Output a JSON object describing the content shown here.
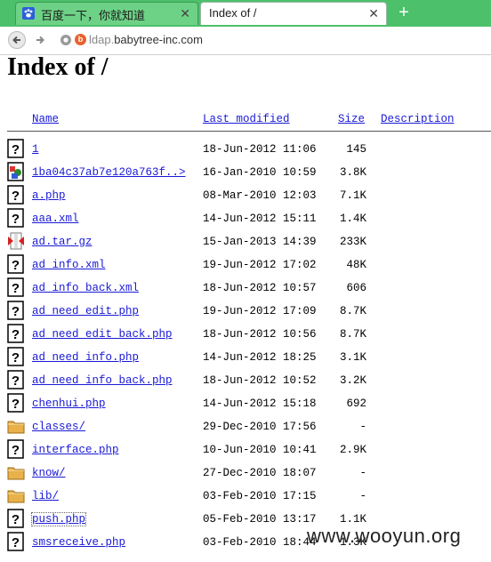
{
  "browser": {
    "tabs": [
      {
        "label": "百度一下，你就知道",
        "close": "✕"
      },
      {
        "label": "Index of /",
        "close": "✕"
      }
    ],
    "new_tab": "+",
    "url_prefix": "ldap.",
    "url_rest": "babytree-inc.com",
    "site_badge": "b"
  },
  "page": {
    "title": "Index of /",
    "columns": {
      "name": "Name",
      "modified": "Last modified",
      "size": "Size",
      "description": "Description"
    },
    "rows": [
      {
        "icon": "unknown-file",
        "name": "1",
        "date": "18-Jun-2012 11:06",
        "size": "145"
      },
      {
        "icon": "image-file",
        "name": "1ba04c37ab7e120a763f..>",
        "date": "16-Jan-2010 10:59",
        "size": "3.8K"
      },
      {
        "icon": "unknown-file",
        "name": "a.php",
        "date": "08-Mar-2010 12:03",
        "size": "7.1K"
      },
      {
        "icon": "unknown-file",
        "name": "aaa.xml",
        "date": "14-Jun-2012 15:11",
        "size": "1.4K"
      },
      {
        "icon": "archive-file",
        "name": "ad.tar.gz",
        "date": "15-Jan-2013 14:39",
        "size": "233K"
      },
      {
        "icon": "unknown-file",
        "name": "ad_info.xml",
        "date": "19-Jun-2012 17:02",
        "size": "48K"
      },
      {
        "icon": "unknown-file",
        "name": "ad_info_back.xml",
        "date": "18-Jun-2012 10:57",
        "size": "606"
      },
      {
        "icon": "unknown-file",
        "name": "ad_need_edit.php",
        "date": "19-Jun-2012 17:09",
        "size": "8.7K"
      },
      {
        "icon": "unknown-file",
        "name": "ad_need_edit_back.php",
        "date": "18-Jun-2012 10:56",
        "size": "8.7K"
      },
      {
        "icon": "unknown-file",
        "name": "ad_need_info.php",
        "date": "14-Jun-2012 18:25",
        "size": "3.1K"
      },
      {
        "icon": "unknown-file",
        "name": "ad_need_info_back.php",
        "date": "18-Jun-2012 10:52",
        "size": "3.2K"
      },
      {
        "icon": "unknown-file",
        "name": "chenhui.php",
        "date": "14-Jun-2012 15:18",
        "size": "692"
      },
      {
        "icon": "folder",
        "name": "classes/",
        "date": "29-Dec-2010 17:56",
        "size": "-"
      },
      {
        "icon": "unknown-file",
        "name": "interface.php",
        "date": "10-Jun-2010 10:41",
        "size": "2.9K"
      },
      {
        "icon": "folder",
        "name": "know/",
        "date": "27-Dec-2010 18:07",
        "size": "-"
      },
      {
        "icon": "folder",
        "name": "lib/",
        "date": "03-Feb-2010 17:15",
        "size": "-"
      },
      {
        "icon": "unknown-file",
        "name": "push.php",
        "date": "05-Feb-2010 13:17",
        "size": "1.1K"
      },
      {
        "icon": "unknown-file",
        "name": "smsreceive.php",
        "date": "03-Feb-2010 18:44",
        "size": "1.3K"
      }
    ]
  },
  "watermark": "www.wooyun.org",
  "colors": {
    "tabbar": "#4cc06a",
    "link": "#1a1ad6",
    "folder": "#e8b14a"
  }
}
